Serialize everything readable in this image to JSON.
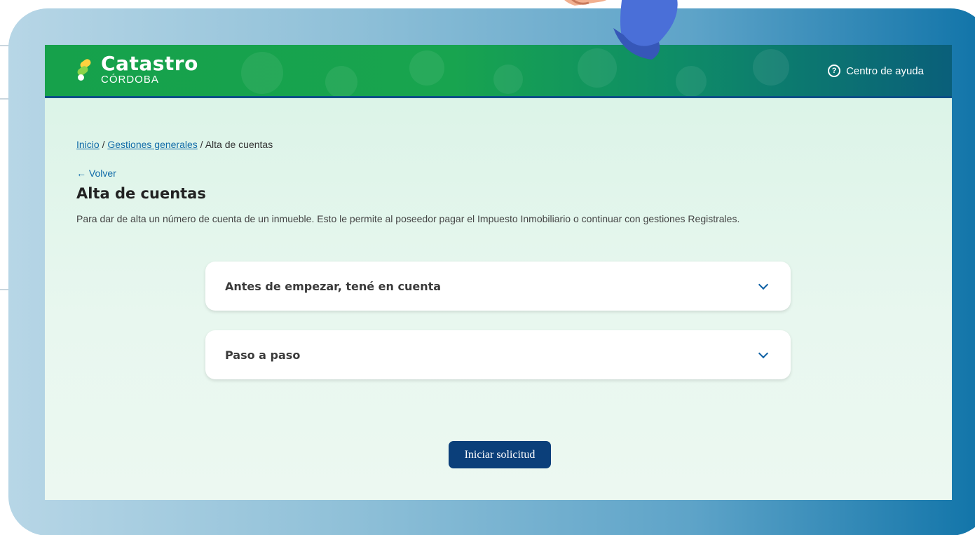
{
  "header": {
    "logo_title": "Catastro",
    "logo_subtitle": "CÓRDOBA",
    "help_label": "Centro de ayuda"
  },
  "breadcrumb": {
    "items": [
      "Inicio",
      "Gestiones generales"
    ],
    "separator": "/",
    "current": "Alta de cuentas"
  },
  "back_link": "← Volver",
  "page": {
    "title": "Alta de cuentas",
    "description": "Para dar de alta un número de cuenta de un inmueble. Esto le permite al poseedor pagar el Impuesto Inmobiliario o continuar con gestiones Registrales."
  },
  "accordions": [
    {
      "title": "Antes de empezar, tené en cuenta"
    },
    {
      "title": "Paso a paso"
    }
  ],
  "actions": {
    "start_label": "Iniciar solicitud"
  },
  "colors": {
    "header_green": "#16a14b",
    "header_blue": "#0a5f7a",
    "primary_button": "#0b3f7a",
    "link": "#0f6aa8",
    "frame_blue": "#0f73a8"
  },
  "icons": {
    "help": "help-circle-icon",
    "chevron": "chevron-down-icon",
    "back": "arrow-left-icon"
  }
}
